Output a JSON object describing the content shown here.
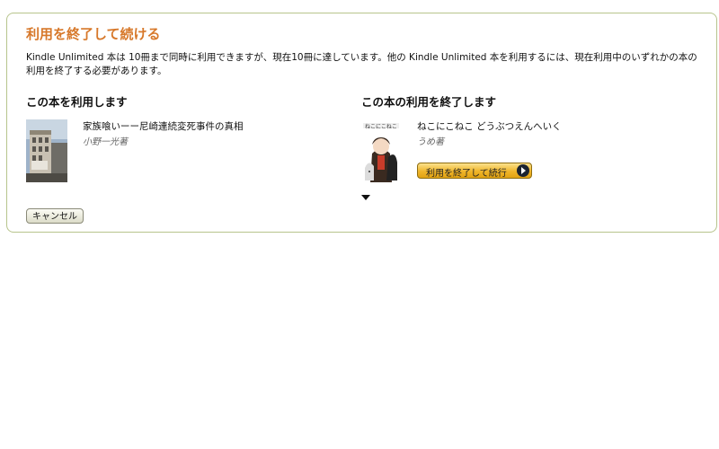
{
  "dialog": {
    "title": "利用を終了して続ける",
    "description": "Kindle Unlimited 本は 10冊まで同時に利用できますが、現在10冊に達しています。他の Kindle Unlimited 本を利用するには、現在利用中のいずれかの本の利用を終了する必要があります。",
    "cancel_label": "キャンセル"
  },
  "left": {
    "heading": "この本を利用します",
    "book": {
      "title": "家族喰いーー尼崎連続変死事件の真相",
      "author": "小野一光著"
    }
  },
  "right": {
    "heading": "この本の利用を終了します",
    "book": {
      "title": "ねこにこねこ どうぶつえんへいく",
      "author": "うめ著"
    },
    "action_label": "利用を終了して続行"
  },
  "colors": {
    "title": "#d7782a",
    "border": "#b7c48c",
    "button_gold": "#efb52a"
  }
}
